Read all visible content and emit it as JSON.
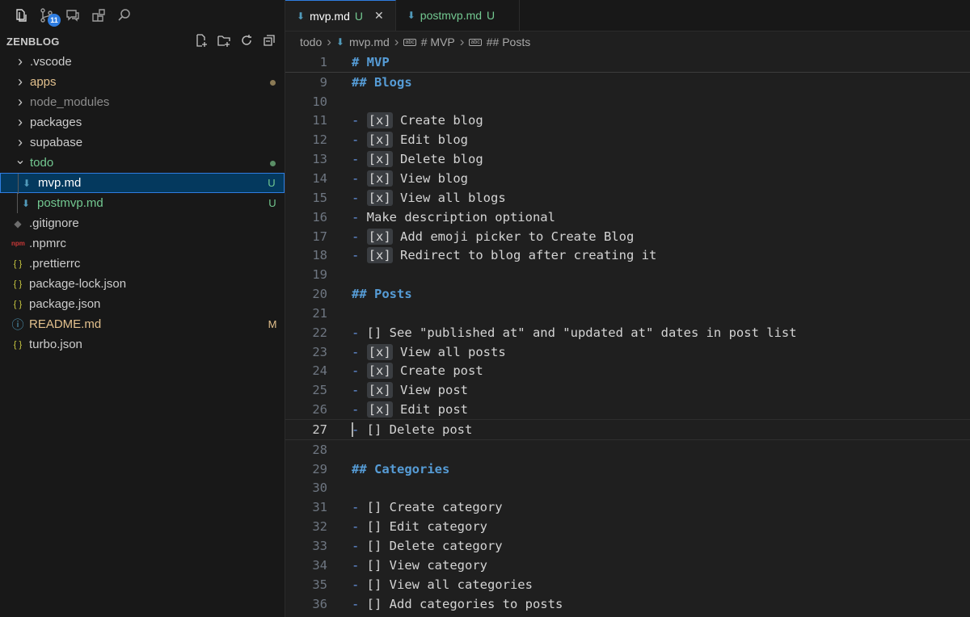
{
  "activity": {
    "scm_badge": "11"
  },
  "explorer": {
    "title": "ZENBLOG",
    "items": [
      {
        "name": ".vscode",
        "type": "folder",
        "expanded": false,
        "color": "#cccccc"
      },
      {
        "name": "apps",
        "type": "folder",
        "expanded": false,
        "color": "#e2c08d",
        "dot": "#8b7a55"
      },
      {
        "name": "node_modules",
        "type": "folder",
        "expanded": false,
        "color": "#8c8c8c"
      },
      {
        "name": "packages",
        "type": "folder",
        "expanded": false,
        "color": "#cccccc"
      },
      {
        "name": "supabase",
        "type": "folder",
        "expanded": false,
        "color": "#cccccc"
      },
      {
        "name": "todo",
        "type": "folder",
        "expanded": true,
        "color": "#73c991",
        "dot": "#5a8f66"
      },
      {
        "name": "mvp.md",
        "type": "md",
        "nested": true,
        "color": "#ffffff",
        "status": "U",
        "selected": true
      },
      {
        "name": "postmvp.md",
        "type": "md",
        "nested": true,
        "color": "#73c991",
        "status": "U"
      },
      {
        "name": ".gitignore",
        "type": "git",
        "color": "#cccccc"
      },
      {
        "name": ".npmrc",
        "type": "npm",
        "color": "#cccccc"
      },
      {
        "name": ".prettierrc",
        "type": "json",
        "color": "#cccccc"
      },
      {
        "name": "package-lock.json",
        "type": "json",
        "color": "#cccccc"
      },
      {
        "name": "package.json",
        "type": "json",
        "color": "#cccccc"
      },
      {
        "name": "README.md",
        "type": "info",
        "color": "#e2c08d",
        "status": "M"
      },
      {
        "name": "turbo.json",
        "type": "json",
        "color": "#cccccc"
      }
    ]
  },
  "tabs": [
    {
      "label": "mvp.md",
      "status": "U",
      "active": true
    },
    {
      "label": "postmvp.md",
      "status": "U",
      "active": false
    }
  ],
  "breadcrumb": [
    "todo",
    "mvp.md",
    "# MVP",
    "## Posts"
  ],
  "code": [
    {
      "n": "1",
      "t": "# MVP",
      "k": "h",
      "sticky": true
    },
    {
      "n": "9",
      "t": "## Blogs",
      "k": "h"
    },
    {
      "n": "10",
      "t": "",
      "k": "p"
    },
    {
      "n": "11",
      "k": "c",
      "chk": "[x]",
      "t": "Create blog"
    },
    {
      "n": "12",
      "k": "c",
      "chk": "[x]",
      "t": "Edit blog"
    },
    {
      "n": "13",
      "k": "c",
      "chk": "[x]",
      "t": "Delete blog"
    },
    {
      "n": "14",
      "k": "c",
      "chk": "[x]",
      "t": "View blog"
    },
    {
      "n": "15",
      "k": "c",
      "chk": "[x]",
      "t": "View all blogs"
    },
    {
      "n": "16",
      "k": "l",
      "t": "Make description optional"
    },
    {
      "n": "17",
      "k": "c",
      "chk": "[x]",
      "t": "Add emoji picker to Create Blog"
    },
    {
      "n": "18",
      "k": "c",
      "chk": "[x]",
      "t": "Redirect to blog after creating it"
    },
    {
      "n": "19",
      "t": "",
      "k": "p"
    },
    {
      "n": "20",
      "t": "## Posts",
      "k": "h"
    },
    {
      "n": "21",
      "t": "",
      "k": "p"
    },
    {
      "n": "22",
      "k": "e",
      "t": "[] See \"published at\" and \"updated at\" dates in post list"
    },
    {
      "n": "23",
      "k": "c",
      "chk": "[x]",
      "t": "View all posts"
    },
    {
      "n": "24",
      "k": "c",
      "chk": "[x]",
      "t": "Create post"
    },
    {
      "n": "25",
      "k": "c",
      "chk": "[x]",
      "t": "View post"
    },
    {
      "n": "26",
      "k": "c",
      "chk": "[x]",
      "t": "Edit post"
    },
    {
      "n": "27",
      "k": "e",
      "t": "[] Delete post",
      "current": true
    },
    {
      "n": "28",
      "t": "",
      "k": "p"
    },
    {
      "n": "29",
      "t": "## Categories",
      "k": "h"
    },
    {
      "n": "30",
      "t": "",
      "k": "p"
    },
    {
      "n": "31",
      "k": "e",
      "t": "[] Create category"
    },
    {
      "n": "32",
      "k": "e",
      "t": "[] Edit category"
    },
    {
      "n": "33",
      "k": "e",
      "t": "[] Delete category"
    },
    {
      "n": "34",
      "k": "e",
      "t": "[] View category"
    },
    {
      "n": "35",
      "k": "e",
      "t": "[] View all categories"
    },
    {
      "n": "36",
      "k": "e",
      "t": "[] Add categories to posts"
    }
  ]
}
